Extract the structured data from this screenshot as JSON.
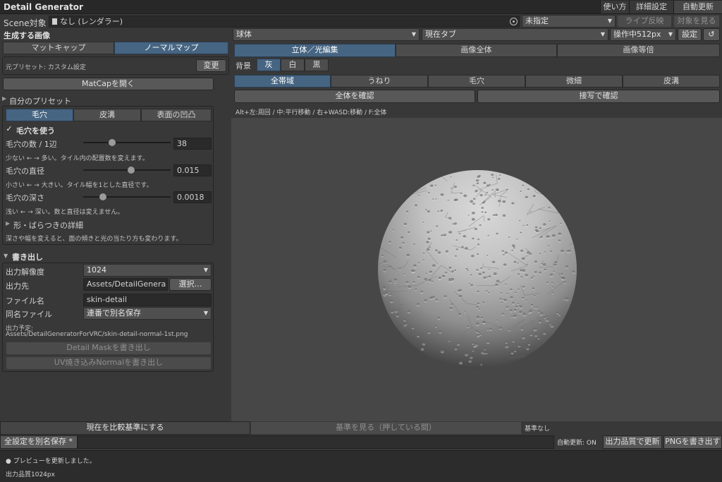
{
  "app": {
    "title": "Detail Generator",
    "header_buttons": [
      "使い方",
      "詳細設定",
      "自動更新"
    ]
  },
  "scene": {
    "label": "Scene対象",
    "object_value": "なし (レンダラー)",
    "unspecified_dropdown": "未指定",
    "live_reflect": "ライブ反映",
    "view_target": "対象を見る"
  },
  "left": {
    "generate_header": "生成する画像",
    "image_tabs": [
      {
        "label": "マットキャップ",
        "selected": false
      },
      {
        "label": "ノーマルマップ",
        "selected": true
      }
    ],
    "source_preset": "元プリセット: カスタム設定",
    "change_button": "変更",
    "open_matcap": "MatCapを開く",
    "my_presets": "自分のプリセット",
    "detail_tabs": [
      {
        "label": "毛穴",
        "selected": true
      },
      {
        "label": "皮溝",
        "selected": false
      },
      {
        "label": "表面の凹凸",
        "selected": false
      }
    ],
    "use_pores_check": "✓",
    "use_pores": "毛穴を使う",
    "params": [
      {
        "label": "毛穴の数 / 1辺",
        "value": "38",
        "fraction": 0.32,
        "hint": "少ない ← → 多い。タイル内の配置数を変えます。"
      },
      {
        "label": "毛穴の直径",
        "value": "0.015",
        "fraction": 0.55,
        "hint": "小さい ← → 大きい。タイル幅を1とした直径です。"
      },
      {
        "label": "毛穴の深さ",
        "value": "0.0018",
        "fraction": 0.2,
        "hint": "浅い ← → 深い。数と直径は変えません。"
      }
    ],
    "shape_detail": "形・ばらつきの詳細",
    "shape_hint": "深さや幅を変えると、面の傾きと光の当たり方も変わります。",
    "export_header": "書き出し",
    "export": {
      "resolution_label": "出力解像度",
      "resolution_value": "1024",
      "dest_label": "出力先",
      "dest_value": "Assets/DetailGenera",
      "select_button": "選択…",
      "filename_label": "ファイル名",
      "filename_value": "skin-detail",
      "samename_label": "同名ファイル",
      "samename_value": "連番で別名保存",
      "planned_label": "出力予定:",
      "planned_path": "Assets/DetailGeneratorForVRC/skin-detail-normal-1st.png",
      "mask_button": "Detail Maskを書き出し",
      "uv_button": "UV焼き込みNormalを書き出し"
    }
  },
  "right": {
    "shape_dropdown": "球体",
    "tab_dropdown": "現在タブ",
    "op_dropdown": "操作中512px",
    "settings_button": "設定",
    "reset_icon": "↺",
    "view_tabs": [
      {
        "label": "立体／光編集",
        "selected": true
      },
      {
        "label": "画像全体",
        "selected": false
      },
      {
        "label": "画像等倍",
        "selected": false
      }
    ],
    "bg_label": "背景",
    "bg_options": [
      {
        "label": "灰",
        "selected": true
      },
      {
        "label": "白",
        "selected": false
      },
      {
        "label": "黒",
        "selected": false
      }
    ],
    "band_tabs": [
      {
        "label": "全帯域",
        "selected": true
      },
      {
        "label": "うねり",
        "selected": false
      },
      {
        "label": "毛穴",
        "selected": false
      },
      {
        "label": "微細",
        "selected": false
      },
      {
        "label": "皮溝",
        "selected": false
      }
    ],
    "check_all": "全体を確認",
    "check_closeup": "接写で確認",
    "controls_hint": "Alt+左:周回 / 中:平行移動 / 右+WASD:移動 / F:全体"
  },
  "bottom": {
    "set_baseline": "現在を比較基準にする",
    "view_baseline": "基準を見る（押している間）",
    "no_baseline": "基準なし",
    "save_all": "全設定を別名保存 *",
    "auto_update_status": "自動更新: ON",
    "quality_update": "出力品質で更新",
    "export_png": "PNGを書き出す",
    "status_line1": "● プレビューを更新しました。",
    "status_line2": "出力品質1024px"
  },
  "colors": {
    "accent_selected": "#466582",
    "panel_bg": "#383838",
    "viewport_bg": "#474747"
  }
}
